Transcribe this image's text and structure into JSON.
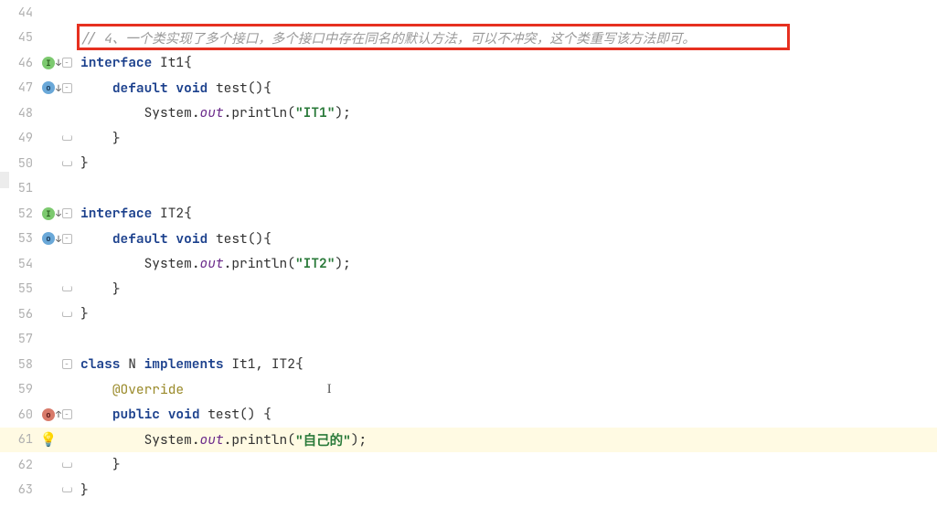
{
  "lines": [
    {
      "num": 44,
      "icon": null,
      "fold": null,
      "tokens": []
    },
    {
      "num": 45,
      "icon": null,
      "fold": null,
      "boxed": true,
      "tokens": [
        {
          "cls": "comment",
          "t": "// 4、一个类实现了多个接口，多个接口中存在同名的默认方法，可以不冲突，这个类重写该方法即可。"
        }
      ]
    },
    {
      "num": 46,
      "icon": "interface",
      "fold": "open",
      "tokens": [
        {
          "cls": "keyword",
          "t": "interface"
        },
        {
          "cls": "punct",
          "t": " "
        },
        {
          "cls": "classname",
          "t": "It1"
        },
        {
          "cls": "punct",
          "t": "{"
        }
      ]
    },
    {
      "num": 47,
      "icon": "override",
      "fold": "open",
      "indent": 1,
      "tokens": [
        {
          "cls": "keyword",
          "t": "default"
        },
        {
          "cls": "punct",
          "t": " "
        },
        {
          "cls": "keyword",
          "t": "void"
        },
        {
          "cls": "punct",
          "t": " "
        },
        {
          "cls": "method",
          "t": "test"
        },
        {
          "cls": "punct",
          "t": "(){"
        }
      ]
    },
    {
      "num": 48,
      "icon": null,
      "fold": null,
      "indent": 2,
      "tokens": [
        {
          "cls": "classname",
          "t": "System"
        },
        {
          "cls": "punct",
          "t": "."
        },
        {
          "cls": "field-italic",
          "t": "out"
        },
        {
          "cls": "punct",
          "t": "."
        },
        {
          "cls": "method",
          "t": "println"
        },
        {
          "cls": "punct",
          "t": "("
        },
        {
          "cls": "string",
          "t": "\"IT1\""
        },
        {
          "cls": "punct",
          "t": ");"
        }
      ]
    },
    {
      "num": 49,
      "icon": null,
      "fold": "close",
      "indent": 1,
      "tokens": [
        {
          "cls": "punct",
          "t": "}"
        }
      ]
    },
    {
      "num": 50,
      "icon": null,
      "fold": "close",
      "indent": 0,
      "tokens": [
        {
          "cls": "punct",
          "t": "}"
        }
      ]
    },
    {
      "num": 51,
      "icon": null,
      "fold": null,
      "tokens": []
    },
    {
      "num": 52,
      "icon": "interface",
      "fold": "open",
      "tokens": [
        {
          "cls": "keyword",
          "t": "interface"
        },
        {
          "cls": "punct",
          "t": " "
        },
        {
          "cls": "classname",
          "t": "IT2"
        },
        {
          "cls": "punct",
          "t": "{"
        }
      ]
    },
    {
      "num": 53,
      "icon": "override",
      "fold": "open",
      "indent": 1,
      "tokens": [
        {
          "cls": "keyword",
          "t": "default"
        },
        {
          "cls": "punct",
          "t": " "
        },
        {
          "cls": "keyword",
          "t": "void"
        },
        {
          "cls": "punct",
          "t": " "
        },
        {
          "cls": "method",
          "t": "test"
        },
        {
          "cls": "punct",
          "t": "(){"
        }
      ]
    },
    {
      "num": 54,
      "icon": null,
      "fold": null,
      "indent": 2,
      "tokens": [
        {
          "cls": "classname",
          "t": "System"
        },
        {
          "cls": "punct",
          "t": "."
        },
        {
          "cls": "field-italic",
          "t": "out"
        },
        {
          "cls": "punct",
          "t": "."
        },
        {
          "cls": "method",
          "t": "println"
        },
        {
          "cls": "punct",
          "t": "("
        },
        {
          "cls": "string",
          "t": "\"IT2\""
        },
        {
          "cls": "punct",
          "t": ");"
        }
      ]
    },
    {
      "num": 55,
      "icon": null,
      "fold": "close",
      "indent": 1,
      "tokens": [
        {
          "cls": "punct",
          "t": "}"
        }
      ]
    },
    {
      "num": 56,
      "icon": null,
      "fold": "close",
      "indent": 0,
      "tokens": [
        {
          "cls": "punct",
          "t": "}"
        }
      ]
    },
    {
      "num": 57,
      "icon": null,
      "fold": null,
      "tokens": []
    },
    {
      "num": 58,
      "icon": null,
      "fold": "open",
      "tokens": [
        {
          "cls": "keyword",
          "t": "class"
        },
        {
          "cls": "punct",
          "t": " "
        },
        {
          "cls": "classname",
          "t": "N"
        },
        {
          "cls": "punct",
          "t": " "
        },
        {
          "cls": "keyword",
          "t": "implements"
        },
        {
          "cls": "punct",
          "t": " "
        },
        {
          "cls": "classname",
          "t": "It1"
        },
        {
          "cls": "punct",
          "t": ", "
        },
        {
          "cls": "classname",
          "t": "IT2"
        },
        {
          "cls": "punct",
          "t": "{"
        }
      ]
    },
    {
      "num": 59,
      "icon": null,
      "fold": null,
      "indent": 1,
      "caret": true,
      "tokens": [
        {
          "cls": "annotation",
          "t": "@Override"
        }
      ]
    },
    {
      "num": 60,
      "icon": "up",
      "fold": "open",
      "indent": 1,
      "tokens": [
        {
          "cls": "keyword",
          "t": "public"
        },
        {
          "cls": "punct",
          "t": " "
        },
        {
          "cls": "keyword",
          "t": "void"
        },
        {
          "cls": "punct",
          "t": " "
        },
        {
          "cls": "method",
          "t": "test"
        },
        {
          "cls": "punct",
          "t": "() {"
        }
      ]
    },
    {
      "num": 61,
      "icon": "bulb",
      "fold": null,
      "indent": 2,
      "highlight": true,
      "tokens": [
        {
          "cls": "classname",
          "t": "System"
        },
        {
          "cls": "punct",
          "t": "."
        },
        {
          "cls": "field-italic",
          "t": "out"
        },
        {
          "cls": "punct",
          "t": "."
        },
        {
          "cls": "method",
          "t": "println"
        },
        {
          "cls": "punct",
          "t": "("
        },
        {
          "cls": "string",
          "t": "\"自己的\""
        },
        {
          "cls": "punct",
          "t": ");"
        }
      ]
    },
    {
      "num": 62,
      "icon": null,
      "fold": "close",
      "indent": 1,
      "tokens": [
        {
          "cls": "punct",
          "t": "}"
        }
      ]
    },
    {
      "num": 63,
      "icon": null,
      "fold": "close",
      "indent": 0,
      "tokens": [
        {
          "cls": "punct",
          "t": "}"
        }
      ]
    }
  ],
  "icon_glyphs": {
    "interface": "I",
    "override": "o",
    "up": "o"
  },
  "badge_line": 51
}
